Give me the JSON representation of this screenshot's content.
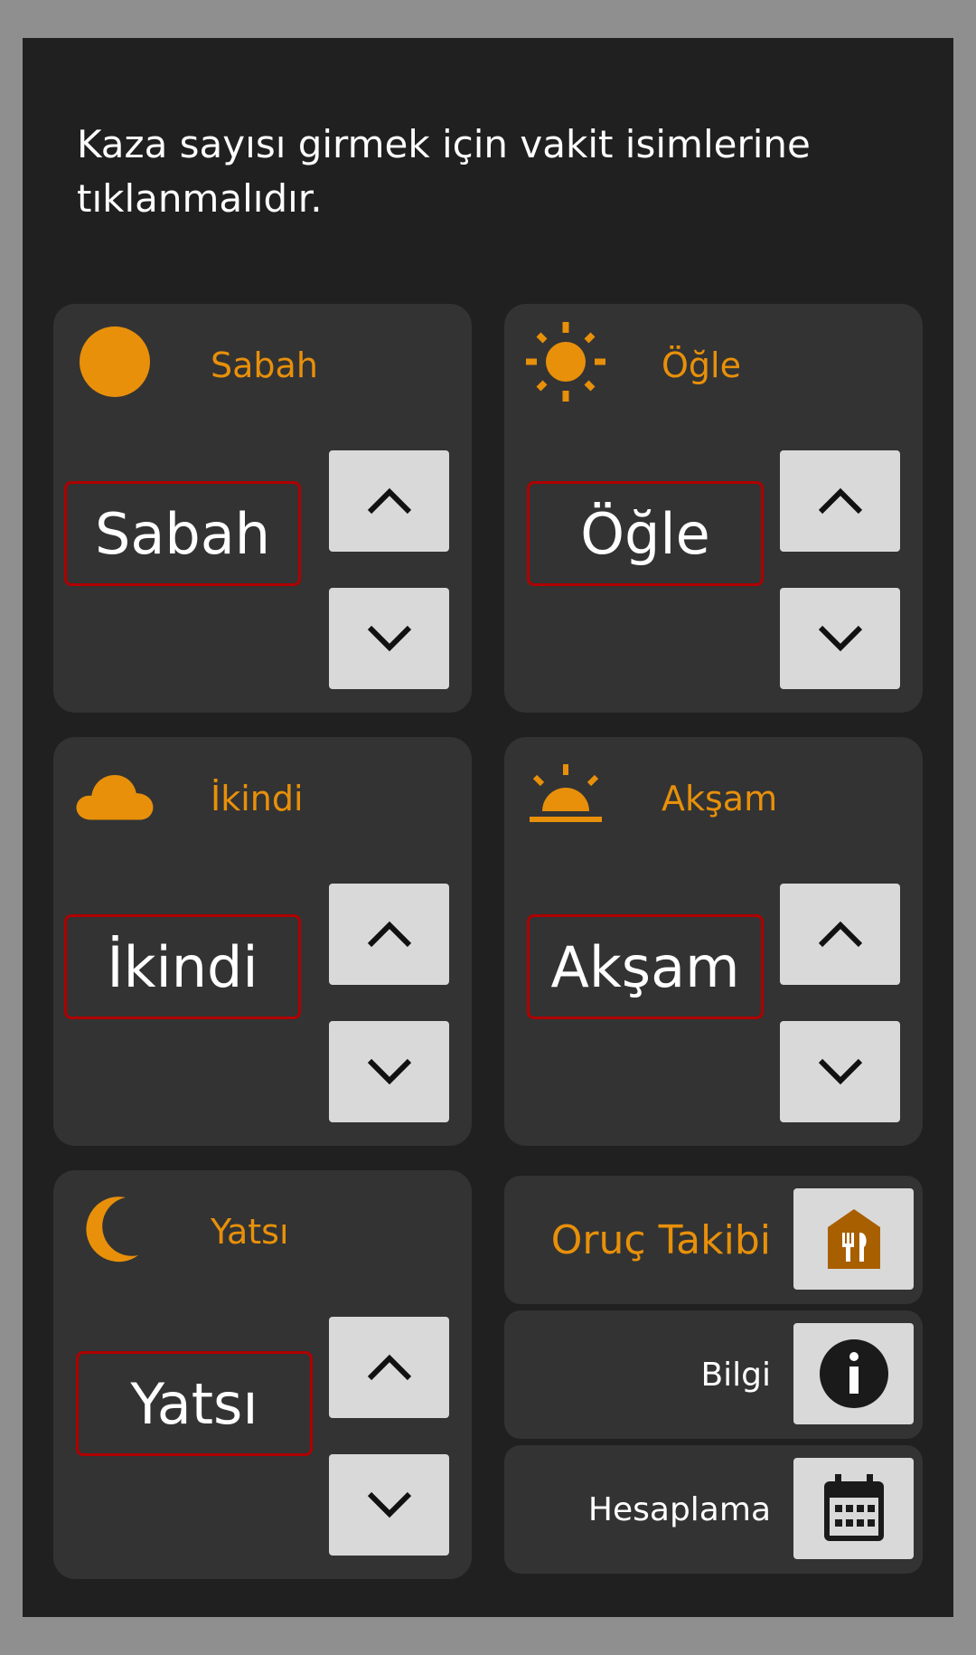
{
  "info": {
    "text": "Kaza sayısı girmek için vakit isimlerine tıklanmalıdır."
  },
  "prayers": [
    {
      "title": "Sabah",
      "name": "Sabah",
      "icon": "moon-full-icon"
    },
    {
      "title": "Öğle",
      "name": "Öğle",
      "icon": "sun-icon"
    },
    {
      "title": "İkindi",
      "name": "İkindi",
      "icon": "cloud-icon"
    },
    {
      "title": "Akşam",
      "name": "Akşam",
      "icon": "sunset-icon"
    },
    {
      "title": "Yatsı",
      "name": "Yatsı",
      "icon": "crescent-moon-icon"
    }
  ],
  "actions": {
    "fasting": {
      "label": "Oruç Takibi",
      "icon": "restaurant-icon"
    },
    "info": {
      "label": "Bilgi",
      "icon": "info-icon"
    },
    "calc": {
      "label": "Hesaplama",
      "icon": "calendar-icon"
    }
  },
  "colors": {
    "accent": "#e8900a",
    "background": "#202020",
    "card": "#333333",
    "name_border": "#b00000",
    "button": "#d9d9d9"
  }
}
